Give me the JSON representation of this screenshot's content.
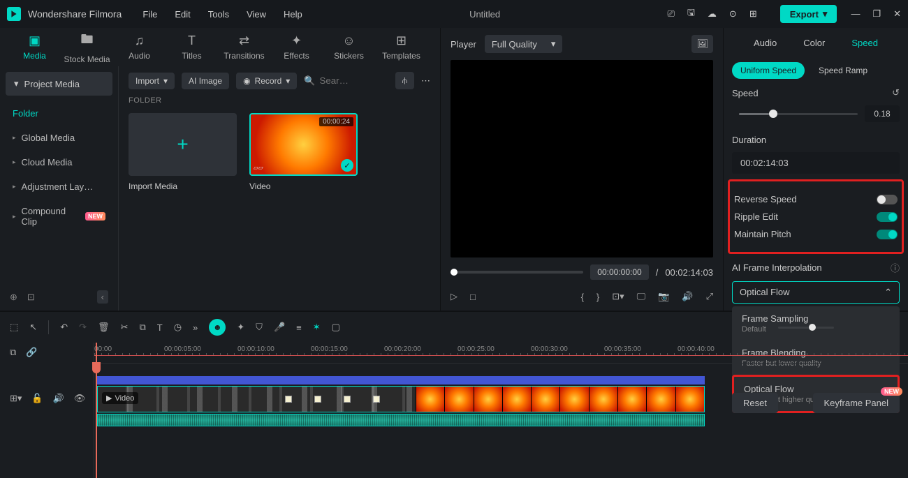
{
  "app": {
    "name": "Wondershare Filmora",
    "title": "Untitled"
  },
  "menubar": [
    "File",
    "Edit",
    "Tools",
    "View",
    "Help"
  ],
  "export_label": "Export",
  "media_tabs": [
    {
      "label": "Media",
      "icon": "▣"
    },
    {
      "label": "Stock Media",
      "icon": "🖿"
    },
    {
      "label": "Audio",
      "icon": "♫"
    },
    {
      "label": "Titles",
      "icon": "T"
    },
    {
      "label": "Transitions",
      "icon": "⇄"
    },
    {
      "label": "Effects",
      "icon": "✦"
    },
    {
      "label": "Stickers",
      "icon": "☺"
    },
    {
      "label": "Templates",
      "icon": "⊞"
    }
  ],
  "media_sidebar": {
    "project_media": "Project Media",
    "folder": "Folder",
    "items": [
      "Global Media",
      "Cloud Media",
      "Adjustment Lay…",
      "Compound Clip"
    ]
  },
  "media_toolbar": {
    "import": "Import",
    "ai_image": "AI Image",
    "record": "Record",
    "search_placeholder": "Sear…"
  },
  "folder_header": "FOLDER",
  "media_items": {
    "import_label": "Import Media",
    "video_label": "Video",
    "video_duration": "00:00:24"
  },
  "preview": {
    "player": "Player",
    "quality": "Full Quality",
    "current_time": "00:00:00:00",
    "sep": "/",
    "total_time": "00:02:14:03"
  },
  "props": {
    "tabs": [
      "Audio",
      "Color",
      "Speed"
    ],
    "subtabs": [
      "Uniform Speed",
      "Speed Ramp"
    ],
    "speed_label": "Speed",
    "speed_value": "0.18",
    "duration_label": "Duration",
    "duration_value": "00:02:14:03",
    "reverse": "Reverse Speed",
    "ripple": "Ripple Edit",
    "pitch": "Maintain Pitch",
    "interp_label": "AI Frame Interpolation",
    "interp_value": "Optical Flow",
    "options": [
      {
        "title": "Frame Sampling",
        "sub": "Default"
      },
      {
        "title": "Frame Blending",
        "sub": "Faster but lower quality"
      },
      {
        "title": "Optical Flow",
        "sub": "Slower but higher quality"
      }
    ],
    "reset": "Reset",
    "keyframe": "Keyframe Panel",
    "new_badge": "NEW"
  },
  "timeline": {
    "ticks": [
      "00:00",
      "00:00:05:00",
      "00:00:10:00",
      "00:00:15:00",
      "00:00:20:00",
      "00:00:25:00",
      "00:00:30:00",
      "00:00:35:00",
      "00:00:40:00"
    ],
    "clip_label": "Video"
  }
}
